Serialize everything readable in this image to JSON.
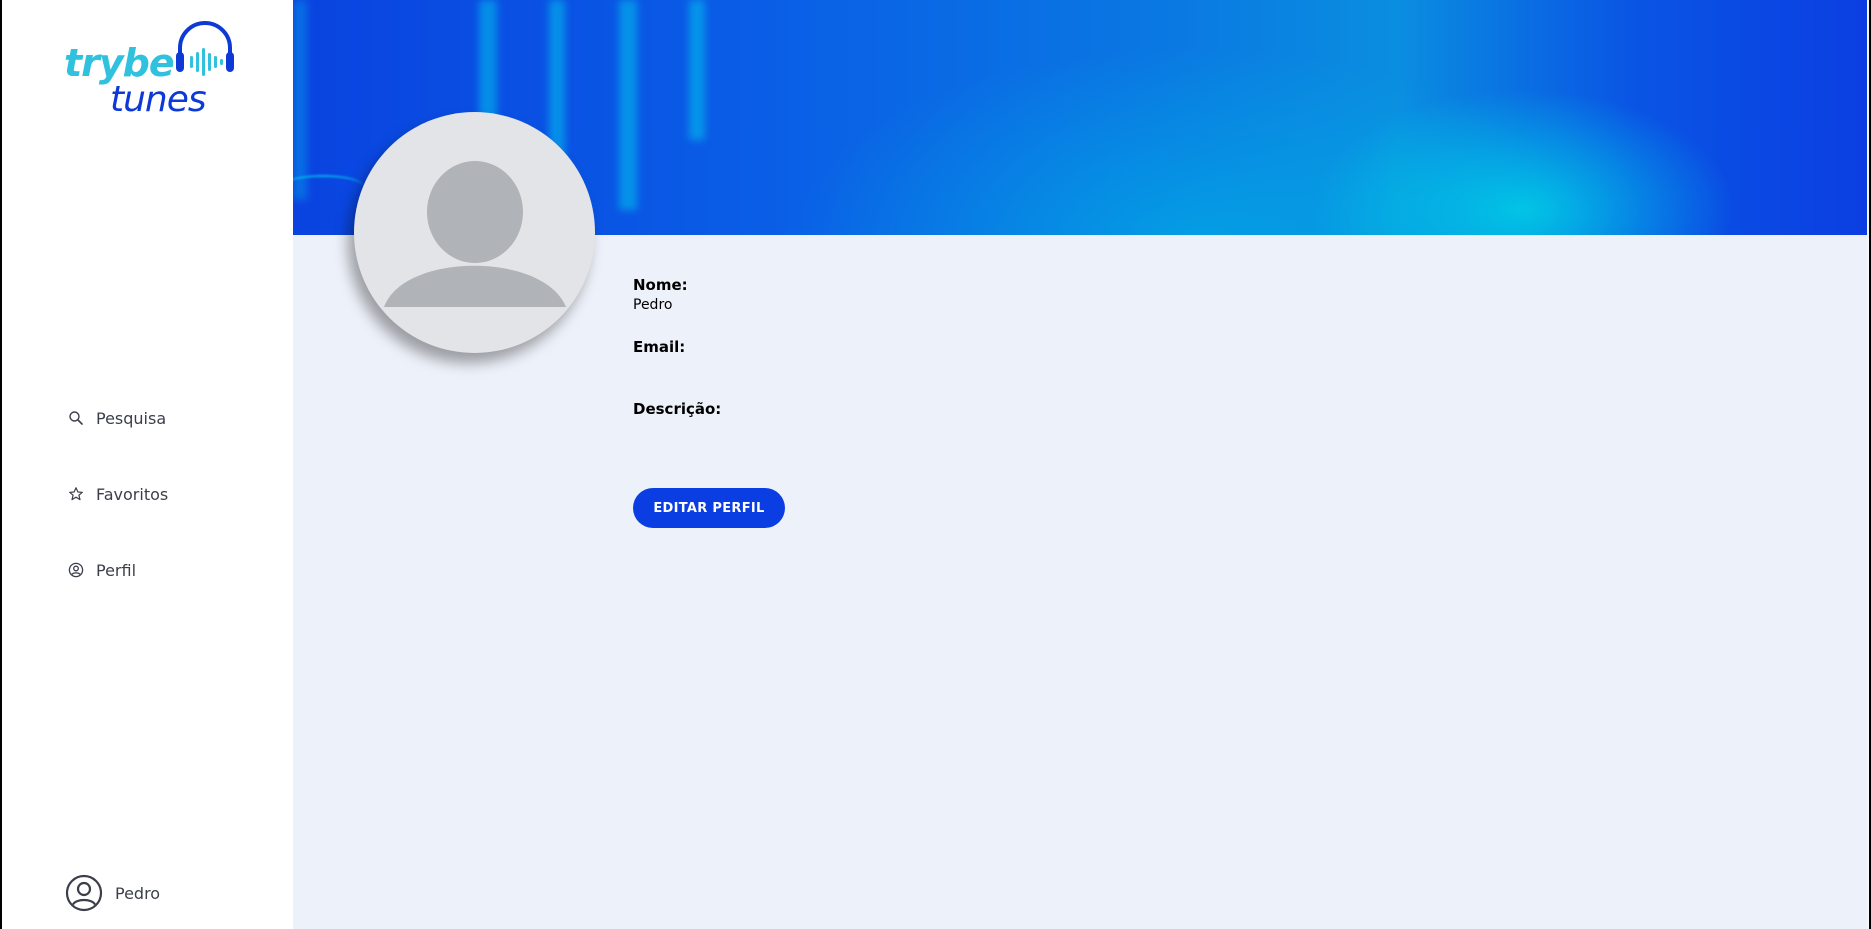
{
  "app": {
    "logo_text_top": "trybe",
    "logo_text_bottom": "tunes",
    "brand_cyan": "#2fc1de",
    "brand_blue": "#0d3ad6"
  },
  "sidebar": {
    "items": [
      {
        "label": "Pesquisa",
        "icon": "search-icon"
      },
      {
        "label": "Favoritos",
        "icon": "star-icon"
      },
      {
        "label": "Perfil",
        "icon": "user-circle-icon"
      }
    ],
    "user": {
      "name": "Pedro",
      "icon": "user-circle-icon"
    }
  },
  "profile": {
    "name_label": "Nome:",
    "name_value": "Pedro",
    "email_label": "Email:",
    "email_value": "",
    "description_label": "Descrição:",
    "description_value": "",
    "edit_button_label": "EDITAR PERFIL"
  },
  "colors": {
    "accent": "#0b3ee2",
    "page_background": "#edf1f9",
    "sidebar_background": "#ffffff"
  }
}
